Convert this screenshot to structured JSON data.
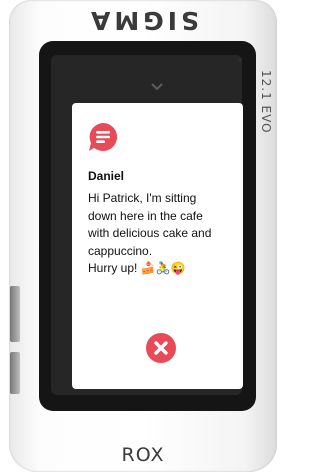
{
  "device": {
    "brand_top": "SIGMA",
    "brand_side": "12.1 EVO",
    "model_label": "ROX"
  },
  "notification": {
    "icon": "chat-bubble-icon",
    "sender": "Daniel",
    "message": "Hi Patrick, I'm sitting\ndown here in the cafe\nwith delicious cake and\ncappuccino.\nHurry up! 🍰🚴😜",
    "dismiss_icon": "close-icon"
  },
  "colors": {
    "accent": "#e84a58",
    "screen_background": "#262626",
    "card_background": "#ffffff"
  }
}
